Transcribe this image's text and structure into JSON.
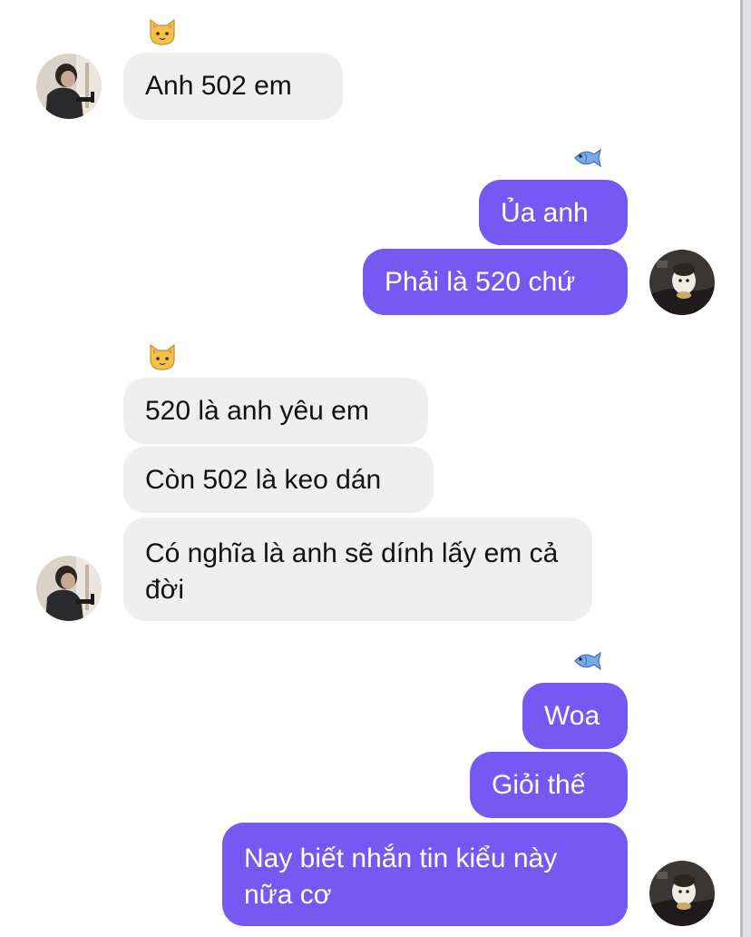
{
  "colors": {
    "outgoing_bubble": "#7559f2",
    "incoming_bubble": "#efefef",
    "incoming_text": "#111111",
    "outgoing_text": "#ffffff"
  },
  "icons": {
    "incoming_reaction": "cat-face-emoji",
    "outgoing_reaction": "fish-emoji",
    "incoming_avatar": "contact-photo-man-at-piano",
    "outgoing_avatar": "my-photo-dark-with-cartoon"
  },
  "messages": [
    {
      "sender": "contact",
      "text": "Anh 502 em"
    },
    {
      "sender": "me",
      "text": "Ủa anh"
    },
    {
      "sender": "me",
      "text": "Phải là 520 chứ"
    },
    {
      "sender": "contact",
      "text": "520 là anh yêu em"
    },
    {
      "sender": "contact",
      "text": "Còn 502 là keo dán"
    },
    {
      "sender": "contact",
      "text": "Có nghĩa là anh sẽ dính lấy em cả đời"
    },
    {
      "sender": "me",
      "text": "Woa"
    },
    {
      "sender": "me",
      "text": "Giỏi thế"
    },
    {
      "sender": "me",
      "text": "Nay biết nhắn tin kiểu này nữa cơ"
    }
  ]
}
